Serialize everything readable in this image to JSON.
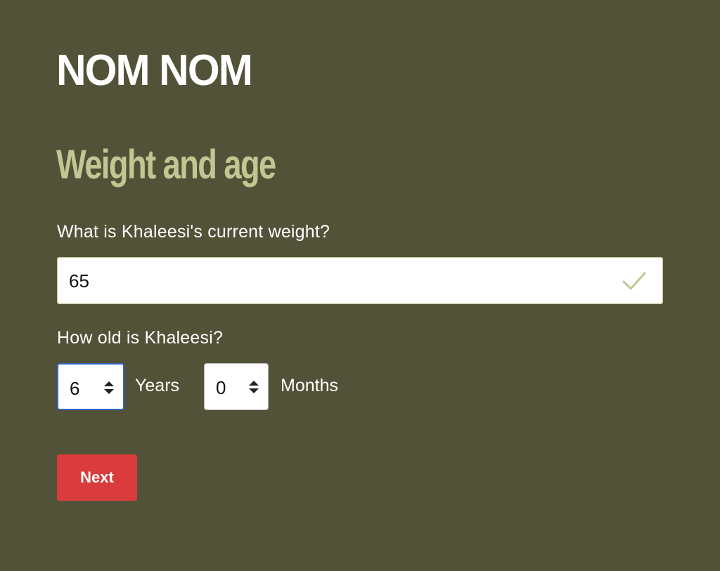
{
  "brand": {
    "logo_text": "NOM NOM"
  },
  "form": {
    "title": "Weight and age",
    "weight": {
      "label": "What is Khaleesi's current weight?",
      "value": "65",
      "status_icon": "check-icon"
    },
    "age": {
      "label": "How old is Khaleesi?",
      "years": {
        "value": "6",
        "unit_label": "Years",
        "icon": "spin-arrows-icon"
      },
      "months": {
        "value": "0",
        "unit_label": "Months",
        "icon": "spin-arrows-icon"
      }
    },
    "next_label": "Next"
  },
  "colors": {
    "background": "#525238",
    "accent_title": "#c3c692",
    "check": "#c3c692",
    "focus_border": "#2f66c8",
    "button": "#da3b3c"
  }
}
